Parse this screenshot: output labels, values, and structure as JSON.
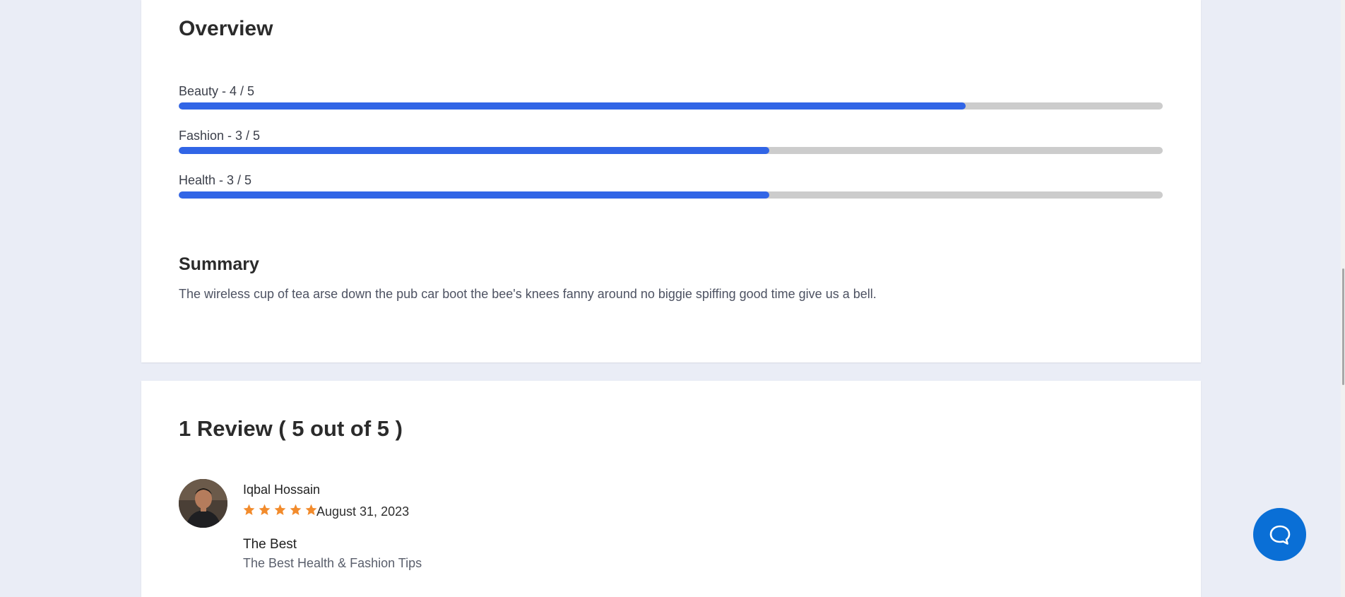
{
  "overview": {
    "title": "Overview",
    "ratings": [
      {
        "label": "Beauty - 4 / 5",
        "value": 4,
        "max": 5
      },
      {
        "label": "Fashion - 3 / 5",
        "value": 3,
        "max": 5
      },
      {
        "label": "Health - 3 / 5",
        "value": 3,
        "max": 5
      }
    ]
  },
  "summary": {
    "title": "Summary",
    "text": "The wireless cup of tea arse down the pub car boot the bee's knees fanny around no biggie spiffing good time give us a bell."
  },
  "reviews": {
    "title": "1 Review ( 5 out of 5 )",
    "items": [
      {
        "author": "Iqbal Hossain",
        "rating": 5,
        "date": "August 31, 2023",
        "heading": "The Best",
        "body": "The Best Health & Fashion Tips"
      }
    ]
  },
  "colors": {
    "page_background": "#eaedf6",
    "bar_fill": "#3165e6",
    "bar_track": "#cccccc",
    "star": "#f28b2c",
    "chat_button": "#0a6fd6"
  },
  "icons": {
    "star": "star-icon",
    "chat": "chat-bubble-icon"
  }
}
